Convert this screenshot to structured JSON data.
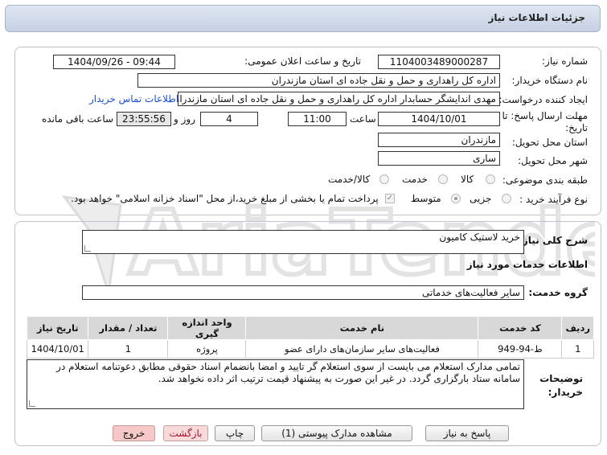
{
  "header": {
    "title": "جزئیات اطلاعات نیاز"
  },
  "form": {
    "need_number_label": "شماره نیاز:",
    "need_number": "1104003489000287",
    "announce_label": "تاریخ و ساعت اعلان عمومی:",
    "announce_value": "1404/09/26 - 09:44",
    "buyer_org_label": "نام دستگاه خریدار:",
    "buyer_org": "اداره کل راهداری و حمل و نقل جاده ای استان مازندران",
    "creator_label": "ایجاد کننده درخواست:",
    "creator": "مهدی اندایشگر حسابدار اداره کل راهداری و حمل و نقل جاده ای استان مازندران",
    "contact_link": "اطلاعات تماس خریدار",
    "deadline_label_line1": "مهلت ارسال پاسخ: تا",
    "deadline_label_line2": "تاریخ:",
    "deadline_date": "1404/10/01",
    "time_label": "ساعت",
    "deadline_time": "11:00",
    "days_value": "4",
    "days_label": "روز و",
    "remaining_time": "23:55:56",
    "remaining_label": "ساعت باقی مانده",
    "province_label": "استان محل تحویل:",
    "province": "مازندران",
    "city_label": "شهر محل تحویل:",
    "city": "ساری",
    "category_label": "طبقه بندی موضوعی:",
    "category_options": [
      "کالا",
      "خدمت",
      "کالا/خدمت"
    ],
    "purchase_type_label": "نوع فرآیند خرید :",
    "purchase_options": [
      "جزیی",
      "متوسط"
    ],
    "payment_note": "پرداخت تمام یا بخشی از مبلغ خرید،از محل \"اسناد خزانه اسلامی\" خواهد بود."
  },
  "summary": {
    "label": "شرح کلی نیاز:",
    "value": "خرید لاستیک کامیون"
  },
  "services": {
    "section_title": "اطلاعات خدمات مورد نیاز",
    "group_label": "گروه خدمت:",
    "group_value": "سایر فعالیت‌های خدماتی",
    "table_headers": [
      "ردیف",
      "کد خدمت",
      "نام خدمت",
      "واحد اندازه گیری",
      "تعداد / مقدار",
      "تاریخ نیاز"
    ],
    "rows": [
      [
        "1",
        "ط-94-949",
        "فعالیت‌های سایر سازمان‌های دارای عضو",
        "پروژه",
        "1",
        "1404/10/01"
      ]
    ]
  },
  "notes": {
    "label_line1": "توضیحات",
    "label_line2": "خریدار:",
    "text": "تمامی مدارک استعلام می بایست از سوی استعلام گر تایید و امضا بانضمام اسناد حقوقی مطابق دعوتنامه استعلام در سامانه ستاد بارگزاری گردد. در غیر این صورت به پیشنهاد قیمت ترتیب اثر داده نخواهد شد."
  },
  "buttons": {
    "reply": "پاسخ به نیاز",
    "attachments": "مشاهده مدارک پیوستی (1)",
    "print": "چاپ",
    "back": "بازگشت",
    "exit": "خروج"
  },
  "watermark": {
    "text": "AriaTender.neT"
  },
  "colors": {
    "link": "#1a4fd6",
    "watermark": "#e3e3e3",
    "exit_button": "#f6c8c8"
  }
}
